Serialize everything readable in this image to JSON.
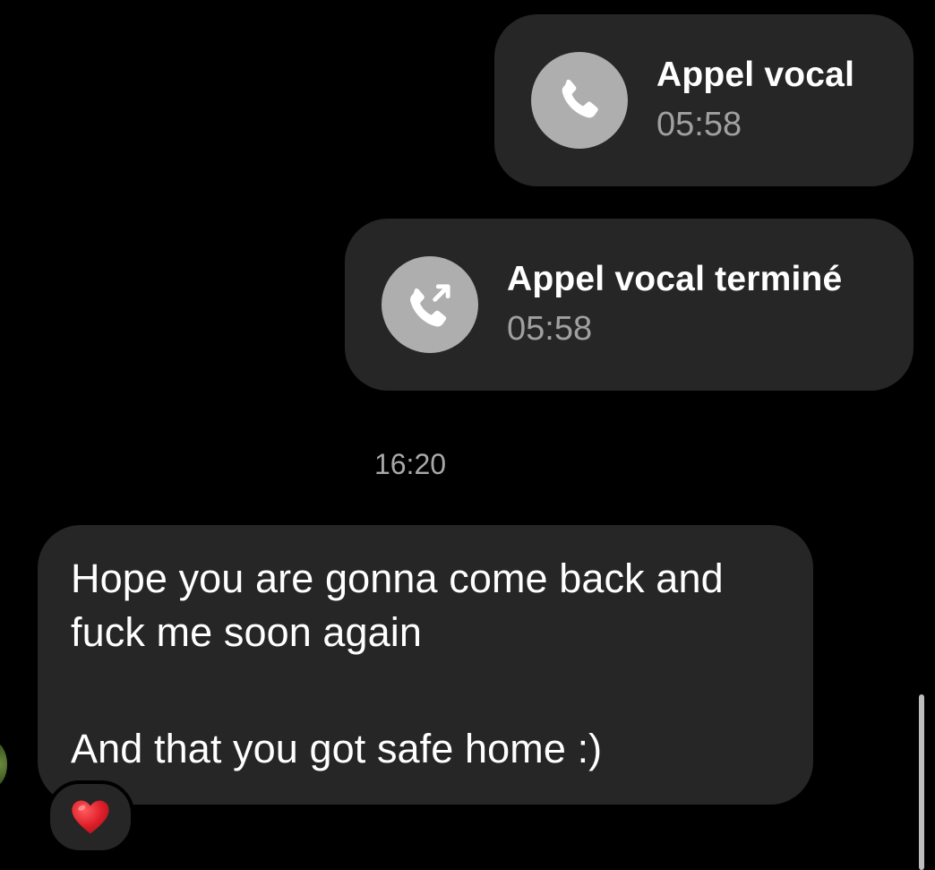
{
  "calls": [
    {
      "title": "Appel vocal",
      "duration": "05:58",
      "icon": "phone-icon"
    },
    {
      "title": "Appel vocal terminé",
      "duration": "05:58",
      "icon": "phone-outgoing-icon"
    }
  ],
  "timestamp": "16:20",
  "message": {
    "lines": [
      "Hope you are gonna come back and",
      "fuck me soon again",
      "And that you got safe home :)"
    ],
    "reaction": "❤️"
  },
  "colors": {
    "background": "#000000",
    "bubble": "#262626",
    "icon_circle": "#aeaeae",
    "secondary_text": "#a0a0a0",
    "heart": "#e0202a"
  }
}
